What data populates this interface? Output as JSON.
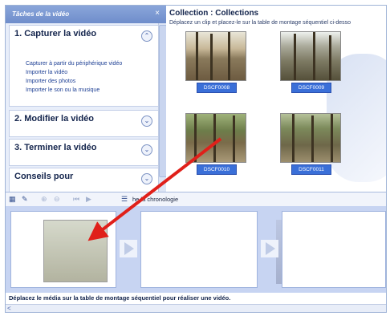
{
  "task_pane": {
    "title": "Tâches de la vidéo",
    "close": "×",
    "sections": [
      {
        "title": "1. Capturer la vidéo",
        "chevron": "⌃",
        "links": [
          "Capturer à partir du périphérique vidéo",
          "Importer la vidéo",
          "Importer des photos",
          "Importer le son ou la musique"
        ]
      },
      {
        "title": "2. Modifier la vidéo",
        "chevron": "⌄"
      },
      {
        "title": "3. Terminer la vidéo",
        "chevron": "⌄"
      },
      {
        "title": "Conseils pour",
        "chevron": "⌄"
      }
    ]
  },
  "collection": {
    "title": "Collection : Collections",
    "subtitle": "Déplacez un clip et placez-le sur la table de montage séquentiel ci-desso",
    "clips": [
      {
        "label": "DSCF0008"
      },
      {
        "label": "DSCF0009"
      },
      {
        "label": "DSCF0010"
      },
      {
        "label": "DSCF0011"
      }
    ]
  },
  "toolbar": {
    "show_timeline_label": "he la chronologie",
    "icons": [
      "storyboard-icon",
      "narration-icon",
      "zoom-in-icon",
      "zoom-out-icon",
      "rewind-icon",
      "play-icon",
      "timeline-toggle-icon"
    ]
  },
  "status": {
    "text": "Déplacez le média sur la table de montage séquentiel pour réaliser une vidéo."
  },
  "scrollbar": {
    "left_arrow": "<"
  },
  "colors": {
    "accent": "#3a6fd8",
    "pane_header": "#7c98d2",
    "storyboard_bg": "#c7d4f2",
    "arrow": "#e0201a"
  }
}
